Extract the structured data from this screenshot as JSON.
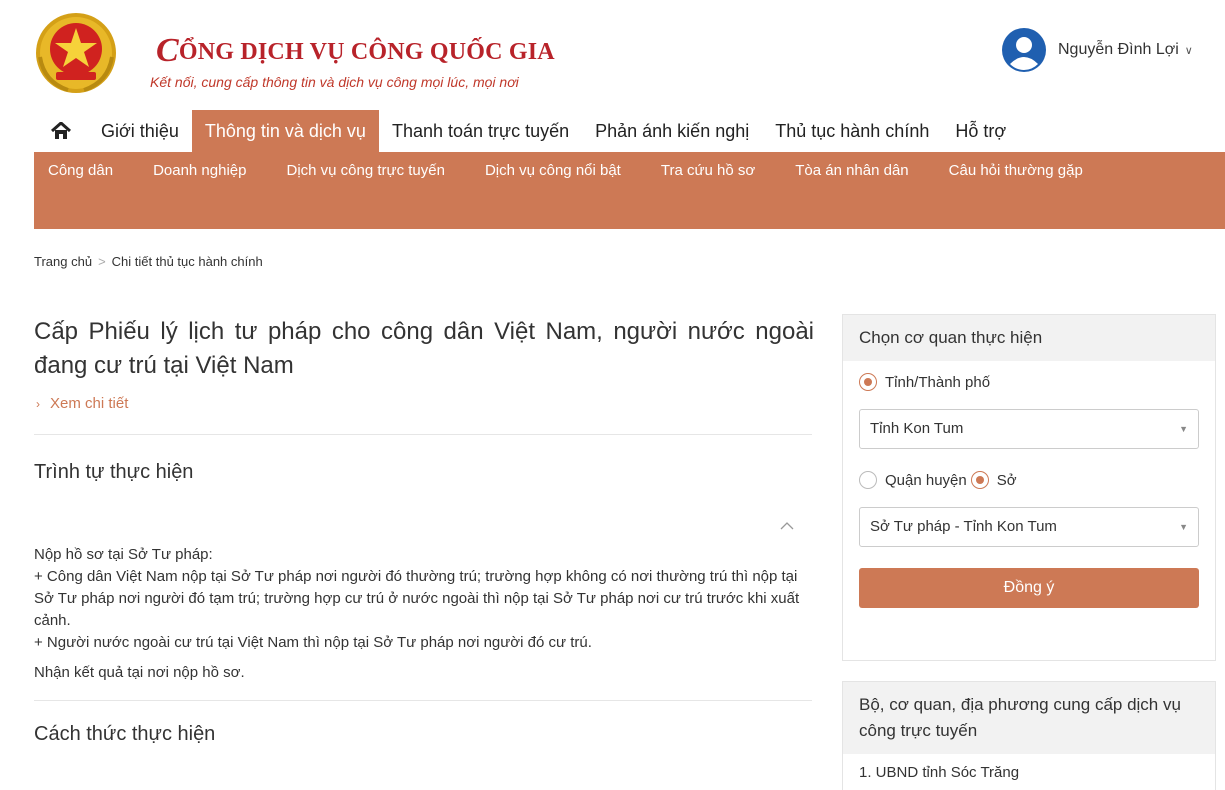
{
  "header": {
    "brand_c": "C",
    "brand_title": "ỔNG DỊCH VỤ CÔNG QUỐC GIA",
    "brand_subtitle": "Kết nối, cung cấp thông tin và dịch vụ công mọi lúc, mọi nơi",
    "user_name": "Nguyễn Đình Lợi",
    "colors": {
      "brand_red": "#b8232a",
      "accent": "#cd7955"
    }
  },
  "mainnav": {
    "home_icon": "home-icon",
    "items": [
      {
        "label": "Giới thiệu"
      },
      {
        "label": "Thông tin và dịch vụ",
        "active": true
      },
      {
        "label": "Thanh toán trực tuyến"
      },
      {
        "label": "Phản ánh kiến nghị"
      },
      {
        "label": "Thủ tục hành chính"
      },
      {
        "label": "Hỗ trợ"
      }
    ]
  },
  "subnav": {
    "items": [
      {
        "label": "Công dân"
      },
      {
        "label": "Doanh nghiệp"
      },
      {
        "label": "Dịch vụ công trực tuyến"
      },
      {
        "label": "Dịch vụ công nổi bật"
      },
      {
        "label": "Tra cứu hồ sơ"
      },
      {
        "label": "Tòa án nhân dân"
      },
      {
        "label": "Câu hỏi thường gặp"
      }
    ]
  },
  "breadcrumb": {
    "home": "Trang chủ",
    "separator": ">",
    "current": "Chi tiết thủ tục hành chính"
  },
  "main": {
    "title": "Cấp Phiếu lý lịch tư pháp cho công dân Việt Nam, người nước ngoài đang cư trú tại Việt Nam",
    "detail_link": "Xem chi tiết",
    "section1_title": "Trình tự thực hiện",
    "section1_lines": [
      "Nộp hồ sơ tại Sở Tư pháp:",
      "+ Công dân Việt Nam nộp tại Sở Tư pháp nơi người đó thường trú; trường hợp không có nơi thường trú thì nộp tại Sở Tư pháp nơi người đó tạm trú; trường hợp cư trú ở nước ngoài thì nộp tại Sở Tư pháp nơi cư trú trước khi xuất cảnh.",
      "+ Người nước ngoài cư trú tại Việt Nam thì nộp tại Sở Tư pháp nơi người đó cư trú."
    ],
    "section1_result": "Nhận kết quả tại nơi nộp hồ sơ.",
    "section2_title": "Cách thức thực hiện"
  },
  "sidebar": {
    "agency_panel": {
      "title": "Chọn cơ quan thực hiện",
      "radio_province": "Tỉnh/Thành phố",
      "province_value": "Tỉnh Kon Tum",
      "radio_district": "Quận huyện",
      "radio_department": "Sở",
      "department_value": "Sở Tư pháp - Tỉnh Kon Tum",
      "submit": "Đồng ý"
    },
    "providers_panel": {
      "title": "Bộ, cơ quan, địa phương cung cấp dịch vụ công trực tuyến",
      "items": [
        "1. UBND tỉnh Sóc Trăng"
      ]
    }
  }
}
